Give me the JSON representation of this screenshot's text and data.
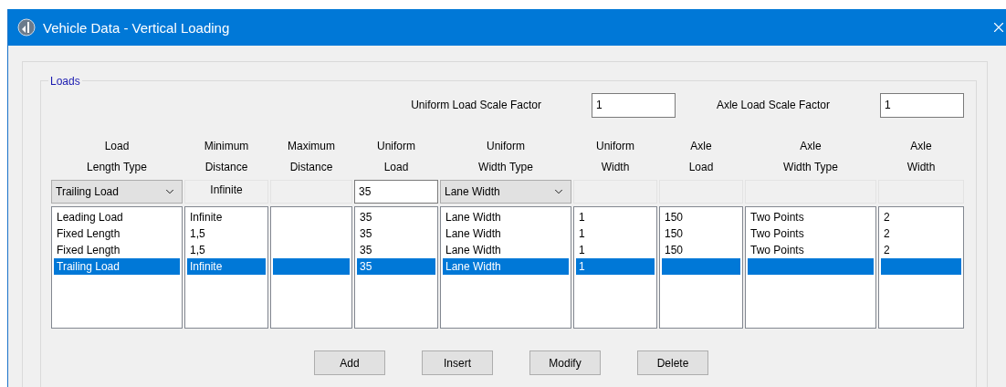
{
  "window": {
    "title": "Vehicle Data - Vertical Loading"
  },
  "group": {
    "title": "Loads"
  },
  "scale_factors": [
    {
      "label": "Uniform Load Scale Factor",
      "value": "1"
    },
    {
      "label": "Axle Load Scale Factor",
      "value": "1"
    }
  ],
  "columns": [
    {
      "header": [
        "Load",
        "Length Type"
      ],
      "editor": {
        "kind": "select",
        "value": "Trailing Load"
      },
      "items": [
        {
          "text": "Leading Load",
          "selected": false
        },
        {
          "text": "Fixed Length",
          "selected": false
        },
        {
          "text": "Fixed Length",
          "selected": false
        },
        {
          "text": "Trailing Load",
          "selected": true
        }
      ]
    },
    {
      "header": [
        "Minimum",
        "Distance"
      ],
      "editor": {
        "kind": "static",
        "value": "Infinite"
      },
      "items": [
        {
          "text": "Infinite",
          "selected": false
        },
        {
          "text": "1,5",
          "selected": false
        },
        {
          "text": "1,5",
          "selected": false
        },
        {
          "text": "Infinite",
          "selected": true
        }
      ]
    },
    {
      "header": [
        "Maximum",
        "Distance"
      ],
      "editor": {
        "kind": "static"
      },
      "items": [
        {
          "selected": false
        },
        {
          "selected": false
        },
        {
          "selected": false
        },
        {
          "selected": true
        }
      ]
    },
    {
      "header": [
        "Uniform",
        "Load"
      ],
      "editor": {
        "kind": "input",
        "value": "35"
      },
      "items": [
        {
          "text": "35",
          "selected": false
        },
        {
          "text": "35",
          "selected": false
        },
        {
          "text": "35",
          "selected": false
        },
        {
          "text": "35",
          "selected": true
        }
      ]
    },
    {
      "header": [
        "Uniform",
        "Width Type"
      ],
      "editor": {
        "kind": "select",
        "value": "Lane Width"
      },
      "items": [
        {
          "text": "Lane Width",
          "selected": false
        },
        {
          "text": "Lane Width",
          "selected": false
        },
        {
          "text": "Lane Width",
          "selected": false
        },
        {
          "text": "Lane Width",
          "selected": true
        }
      ]
    },
    {
      "header": [
        "Uniform",
        "Width"
      ],
      "editor": {
        "kind": "static"
      },
      "items": [
        {
          "text": "1",
          "selected": false
        },
        {
          "text": "1",
          "selected": false
        },
        {
          "text": "1",
          "selected": false
        },
        {
          "text": "1",
          "selected": true
        }
      ]
    },
    {
      "header": [
        "Axle",
        "Load"
      ],
      "editor": {
        "kind": "static"
      },
      "items": [
        {
          "text": "150",
          "selected": false
        },
        {
          "text": "150",
          "selected": false
        },
        {
          "text": "150",
          "selected": false
        },
        {
          "selected": true
        }
      ]
    },
    {
      "header": [
        "Axle",
        "Width Type"
      ],
      "editor": {
        "kind": "static"
      },
      "items": [
        {
          "text": "Two Points",
          "selected": false
        },
        {
          "text": "Two Points",
          "selected": false
        },
        {
          "text": "Two Points",
          "selected": false
        },
        {
          "selected": true
        }
      ]
    },
    {
      "header": [
        "Axle",
        "Width"
      ],
      "editor": {
        "kind": "static"
      },
      "items": [
        {
          "text": "2",
          "selected": false
        },
        {
          "text": "2",
          "selected": false
        },
        {
          "text": "2",
          "selected": false
        },
        {
          "selected": true
        }
      ]
    }
  ],
  "buttons": [
    "Add",
    "Insert",
    "Modify",
    "Delete"
  ]
}
